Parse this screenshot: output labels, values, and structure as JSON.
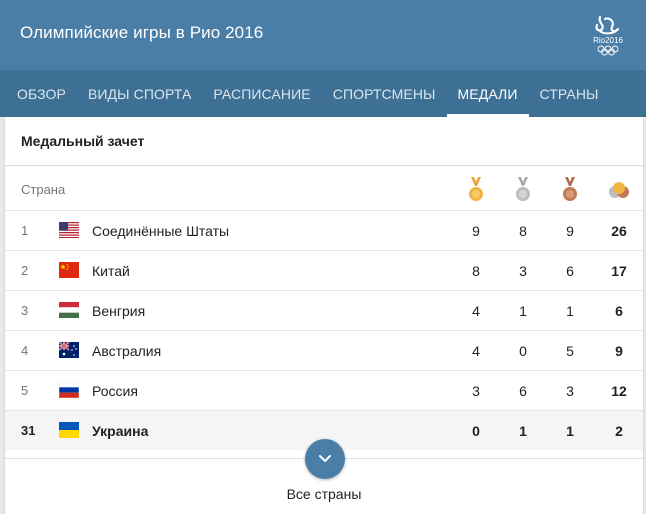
{
  "header": {
    "title": "Олимпийские игры в Рио 2016",
    "logo_text": "Rio2016"
  },
  "tabs": [
    {
      "label": "ОБЗОР"
    },
    {
      "label": "ВИДЫ СПОРТА"
    },
    {
      "label": "РАСПИСАНИЕ"
    },
    {
      "label": "СПОРТСМЕНЫ"
    },
    {
      "label": "МЕДАЛИ",
      "active": true
    },
    {
      "label": "СТРАНЫ"
    }
  ],
  "medals": {
    "title": "Медальный зачет",
    "country_header": "Страна",
    "columns": [
      "gold-medal-icon",
      "silver-medal-icon",
      "bronze-medal-icon",
      "total-medals-icon"
    ],
    "rows": [
      {
        "rank": "1",
        "country": "Соединённые Штаты",
        "flag": "us-flag-icon",
        "gold": "9",
        "silver": "8",
        "bronze": "9",
        "total": "26"
      },
      {
        "rank": "2",
        "country": "Китай",
        "flag": "china-flag-icon",
        "gold": "8",
        "silver": "3",
        "bronze": "6",
        "total": "17"
      },
      {
        "rank": "3",
        "country": "Венгрия",
        "flag": "hungary-flag-icon",
        "gold": "4",
        "silver": "1",
        "bronze": "1",
        "total": "6"
      },
      {
        "rank": "4",
        "country": "Австралия",
        "flag": "australia-flag-icon",
        "gold": "4",
        "silver": "0",
        "bronze": "5",
        "total": "9"
      },
      {
        "rank": "5",
        "country": "Россия",
        "flag": "russia-flag-icon",
        "gold": "3",
        "silver": "6",
        "bronze": "3",
        "total": "12"
      },
      {
        "rank": "31",
        "country": "Украина",
        "flag": "ukraine-flag-icon",
        "gold": "0",
        "silver": "1",
        "bronze": "1",
        "total": "2",
        "highlighted": true
      }
    ],
    "more_label": "Все страны"
  },
  "colors": {
    "header_bg": "#4a7ea6",
    "tabs_bg": "#3e6f95",
    "gold": "#e8a33a",
    "silver": "#bdbdbd",
    "bronze": "#c07a55"
  }
}
